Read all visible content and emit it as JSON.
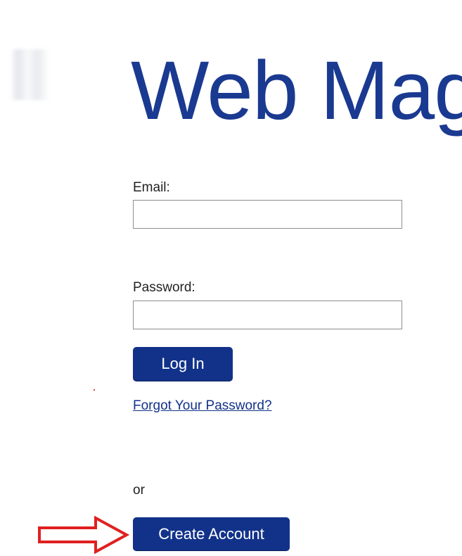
{
  "header": {
    "title": "Web Mag"
  },
  "form": {
    "email_label": "Email:",
    "email_value": "",
    "password_label": "Password:",
    "password_value": "",
    "login_button": "Log In",
    "forgot_link": "Forgot Your Password?",
    "or_text": "or",
    "create_account_button": "Create Account"
  },
  "colors": {
    "brand": "#1a3990",
    "button": "#12328a",
    "annotation_arrow": "#e02020"
  },
  "icons": {
    "annotation": "right-arrow-icon"
  }
}
